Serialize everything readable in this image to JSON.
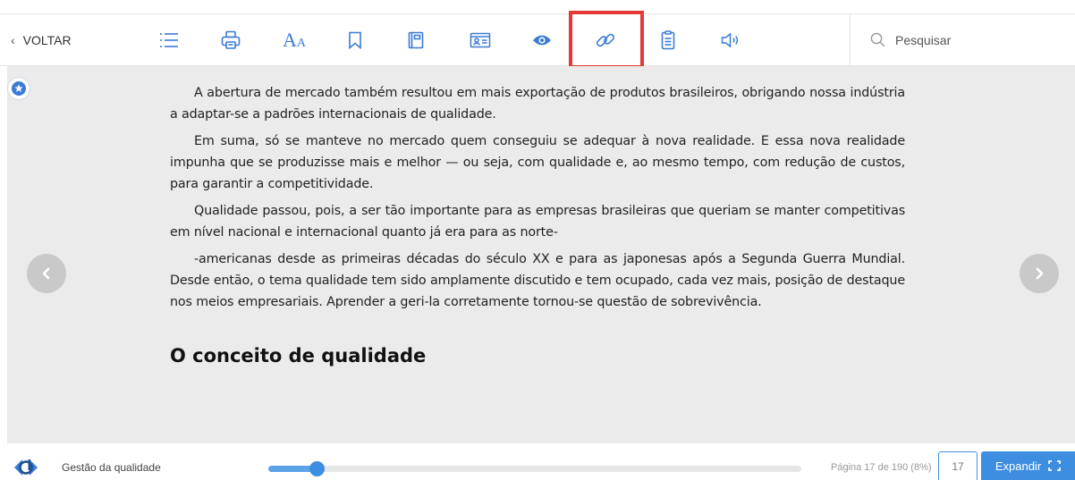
{
  "toolbar": {
    "back_label": "VOLTAR",
    "back_icon": "chevron-left-icon",
    "tools": [
      "list-icon",
      "print-icon",
      "font-size-icon",
      "bookmark-icon",
      "notebook-icon",
      "profile-card-icon",
      "eye-icon",
      "link-icon",
      "document-icon",
      "speaker-icon"
    ],
    "font_tool": {
      "big": "A",
      "small": "A"
    },
    "highlighted_tool": "link-icon",
    "highlight_color": "#e53935",
    "accent_color": "#3a7bd5",
    "search_placeholder": "Pesquisar"
  },
  "reader": {
    "background": "#ebebeb",
    "paragraphs": [
      "A abertura de mercado também resultou em mais exportação de produtos brasileiros, obrigando nossa indústria a adaptar-se a padrões internacionais de qualidade.",
      "Em suma, só se manteve no mercado quem conseguiu se adequar à nova realidade. E essa nova realidade impunha que se produzisse mais e melhor — ou seja, com qualidade e, ao mesmo tempo, com redução de custos, para garantir a competitividade.",
      "Qualidade passou, pois, a ser tão importante para as empresas brasileiras que queriam se manter competitivas em nível nacional e internacional quanto já era para as norte-",
      "-americanas desde as primeiras décadas do século XX e para as japonesas após a Segunda Guerra Mundial. Desde então, o tema qualidade tem sido amplamente discutido e tem ocupado, cada vez mais, posição de destaque nos meios empresariais. Aprender a geri-la corretamente tornou-se questão de sobrevivência."
    ],
    "heading": "O conceito de qualidade"
  },
  "bottombar": {
    "book_title": "Gestão da qualidade",
    "page_info": "Página 17 de 190 (8%)",
    "page_number": "17",
    "progress_fraction": 0.09,
    "expand_label": "Expandir",
    "expand_icon": "fullscreen-icon",
    "accent_color": "#3d8ee0"
  }
}
